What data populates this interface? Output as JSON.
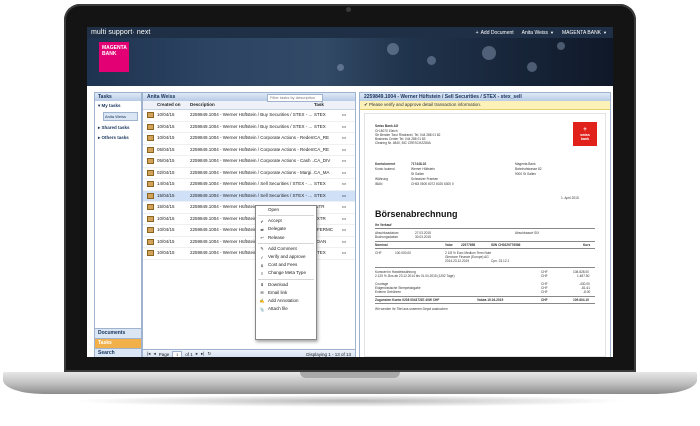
{
  "app": {
    "logo": "multi support· next",
    "add_document": "Add Document",
    "user": "Anita Weiss",
    "bank": "MAGENTA BANK",
    "banner_logo_lines": [
      "MAGENTA",
      "BANK"
    ]
  },
  "left": {
    "header": "Tasks",
    "items": [
      "My tasks",
      "Shared tasks",
      "Others tasks"
    ],
    "chip": "Anita Weiss",
    "bottom": [
      "Documents",
      "Tasks",
      "Search"
    ]
  },
  "mid": {
    "header": "Anita Weiss",
    "filter_placeholder": "Filter tasks by description",
    "columns": [
      "Created on",
      "Description",
      "Task"
    ],
    "rows": [
      {
        "date": "10/04/15",
        "desc": "2259849.1004 - Werner Hüftstein / Buy Securities / STEX - ...",
        "task": "STEX"
      },
      {
        "date": "10/04/15",
        "desc": "2259849.1004 - Werner Hüftstein / Buy Securities / STEX - ...",
        "task": "STEX"
      },
      {
        "date": "10/04/15",
        "desc": "2259849.1004 - Werner Hüftstein / Corporate Actions - Redem...",
        "task": "CA_RE"
      },
      {
        "date": "05/04/15",
        "desc": "2259849.1004 - Werner Hüftstein / Corporate Actions - Redem...",
        "task": "CA_RE"
      },
      {
        "date": "05/04/15",
        "desc": "2259849.1004 - Werner Hüftstein / Corporate Actions - Cash ...",
        "task": "CA_DIV"
      },
      {
        "date": "02/04/15",
        "desc": "2259849.1004 - Werner Hüftstein / Corporate Actions - Margi...",
        "task": "CA_MA"
      },
      {
        "date": "14/04/15",
        "desc": "2259849.1004 - Werner Hüftstein / Sell Securities / STEX - ...",
        "task": "STEX"
      },
      {
        "date": "15/04/15",
        "desc": "2259849.1004 - Werner Hüftstein / Sell Securities / STEX - ...",
        "task": "STEX"
      },
      {
        "date": "15/04/15",
        "desc": "2259849.1004 - Werner Hüftstein ...",
        "task": "INTR"
      },
      {
        "date": "10/04/15",
        "desc": "2259849.1004 - Werner Hüftstein ...",
        "task": "FXTR"
      },
      {
        "date": "10/04/15",
        "desc": "2259849.1004 - Werner Hüftstein ...",
        "task": "XFERMC"
      },
      {
        "date": "10/04/15",
        "desc": "2259849.1004 - Werner Hüftstein ...",
        "task": "LOAN"
      },
      {
        "date": "10/04/15",
        "desc": "2259849.1004 - Werner Hüftstein ...",
        "task": "STEX"
      }
    ],
    "selected_index": 7,
    "pager": {
      "page_label": "Page",
      "page": "1",
      "of": "of 1",
      "display": "Displaying 1 - 13 of 13"
    }
  },
  "menu": {
    "groups": [
      [
        "Open"
      ],
      [
        "Accept",
        "Delegate",
        "Release"
      ],
      [
        "Add Comment",
        "Verify and approve",
        "Cost and Fees",
        "Change Meta Type"
      ],
      [
        "Download",
        "Email link",
        "Add Annotation",
        "Attach file"
      ]
    ]
  },
  "right": {
    "header": "2259849.1004 - Werner Hüftstein / Sell Securities / STEX - stex_sell",
    "note": "Please verify and approve detail transaction information.",
    "doc": {
      "sender": [
        "Swiss Bank AG",
        "CH-8070 Zürich",
        "Str Bender Torui Rindranei, Tel. 044 288 01 82",
        "Business Center Tel. 044 288 01 83",
        "Clearing Nr. 4840, BIC CRESCHZZ80A"
      ],
      "logo": [
        "swiss",
        "bank"
      ],
      "konto_labels": [
        "Kontokorrent",
        "Konto lautend",
        "",
        "Währung",
        "IBAN"
      ],
      "konto_values": [
        "717448-02",
        "Werner Hüftstein",
        "St Gallen",
        "Schweizer Franken",
        "CH63 0500 6072 6025 6300 0"
      ],
      "address": [
        "Magenta Bank",
        "Bahnhofstrasse 82",
        "9000 St Gallen"
      ],
      "date": "1. April 2015",
      "title": "Börsenabrechnung",
      "subtitle": "Ihr Verkauf",
      "meta_labels": [
        "Abschlussdatum",
        "Buchungsdatum"
      ],
      "meta_values": [
        "27.03.2015",
        "30.03.2015"
      ],
      "meta_right": [
        "Abschlussort SIX"
      ],
      "table_head": [
        "Nominal",
        "Valor",
        "22977658",
        "ISIN CH0229776586",
        "Kurs"
      ],
      "pos_lines": [
        "CHF",
        "100.000.00",
        "2 1/8 % Euro Medium Term Note",
        "Glencore Finance (Europe) AG",
        "2014-23.12.2019",
        "Cpn. 23.12.1"
      ],
      "calc": [
        [
          "Kurswert in Handelswährung",
          "CHF",
          "108.828.00"
        ],
        [
          "2.125 % Zins ab 23.12.2014 bis 01.04.2015 (1252 Tage)",
          "CHF",
          "1.487.50"
        ],
        [
          "Courtage",
          "CHF",
          "-430.00"
        ],
        [
          "Eidgenössische Stempelabgabe",
          "CHF",
          "-81.61"
        ],
        [
          "Externe Gebühren",
          "CHF",
          "-8.00"
        ]
      ],
      "total": [
        "Zugunsten Konto 0208 00437287.40W CHF",
        "Valuta 15.04.2015",
        "CHF",
        "109.804.19"
      ],
      "footer": "Wir werden Ihr Titel aus unserem Depot ausbuchen"
    }
  },
  "colors": {
    "accent": "#1f2f45",
    "magenta": "#e20074",
    "selection": "#cfe0f7",
    "swiss_red": "#e1221a"
  }
}
